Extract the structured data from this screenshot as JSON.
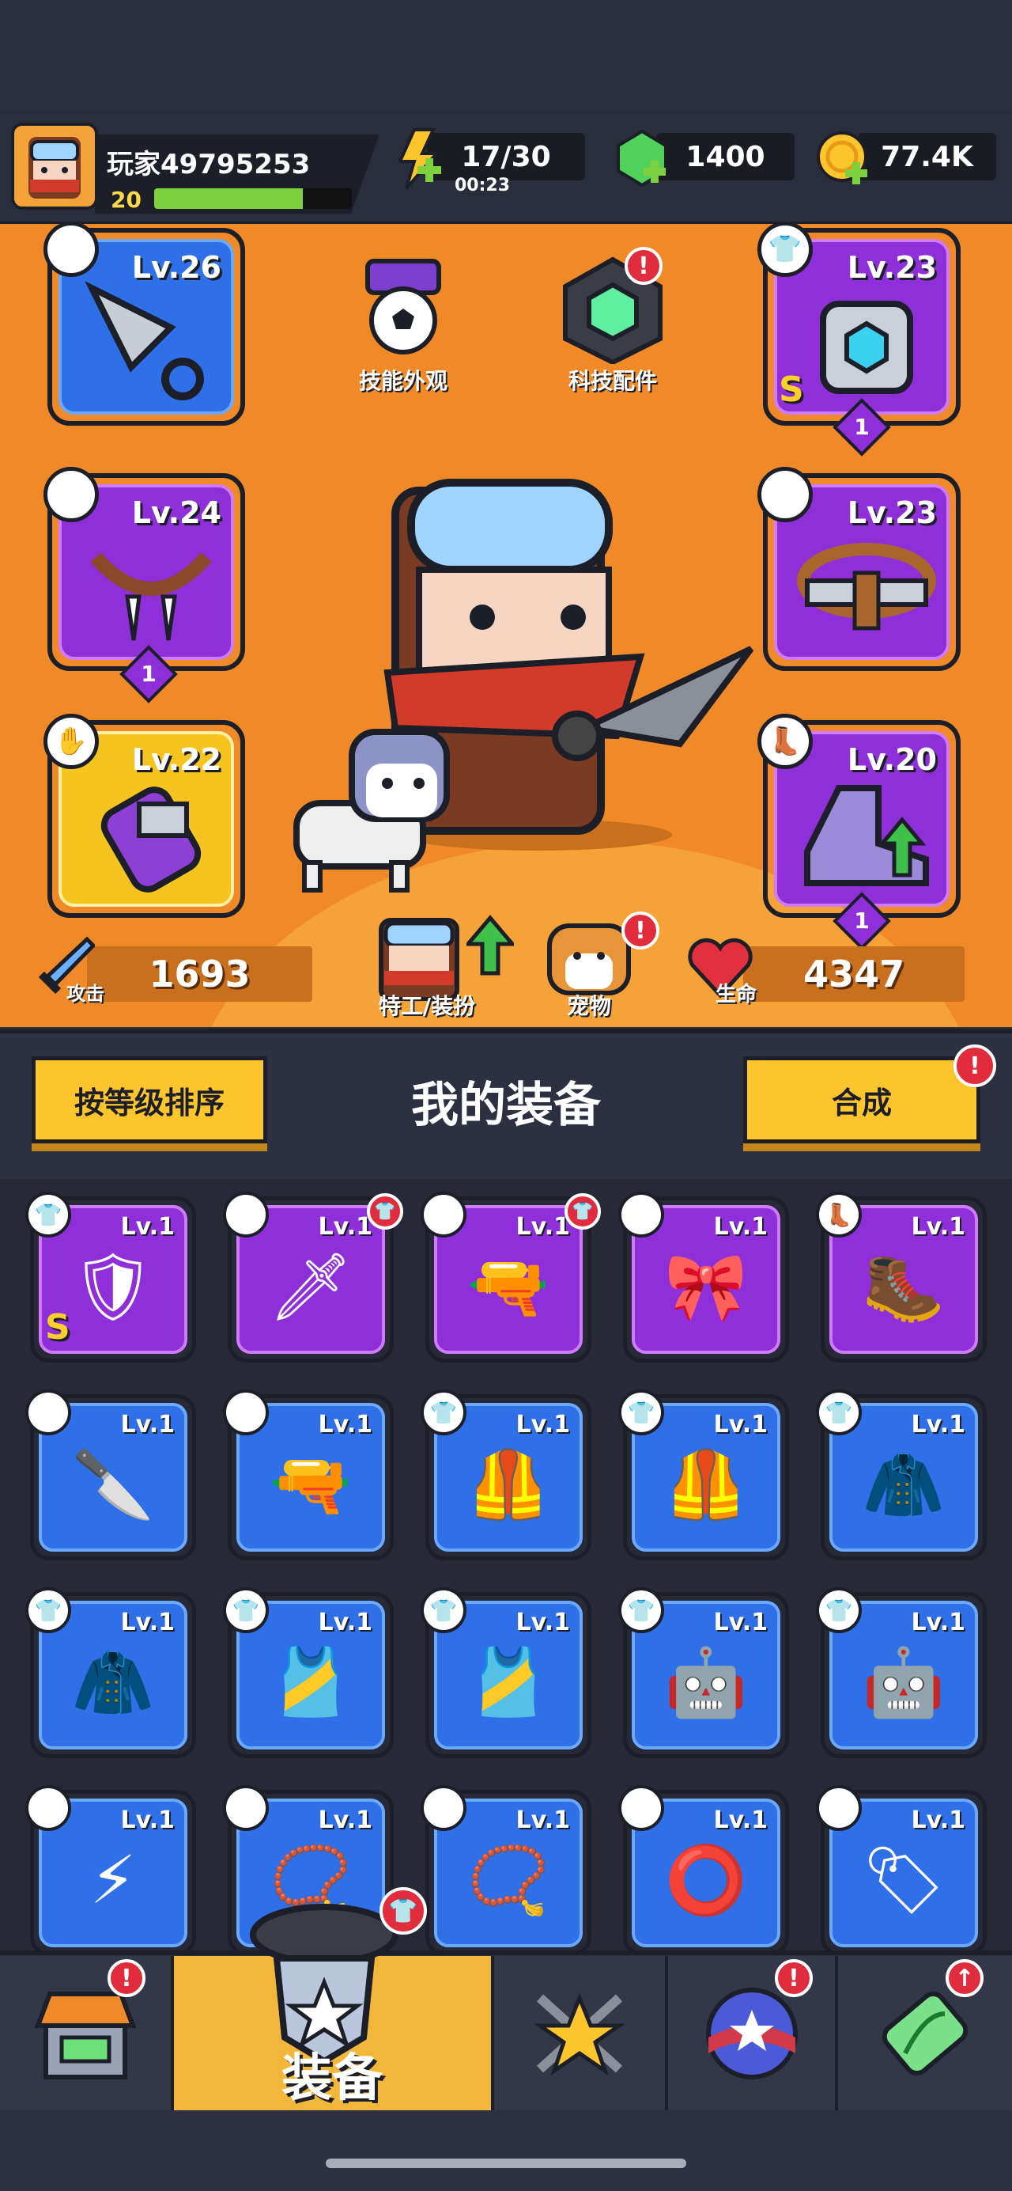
{
  "player": {
    "name": "玩家49795253",
    "level": "20",
    "xp_fraction": 0.75
  },
  "resources": {
    "energy": {
      "value": "17/30",
      "timer": "00:23",
      "icon": "lightning-icon"
    },
    "gems": {
      "value": "1400",
      "icon": "green-gem-icon"
    },
    "coins": {
      "value": "77.4K",
      "icon": "coin-icon"
    }
  },
  "hero_panel": {
    "skill_skin_label": "技能外观",
    "tech_parts_label": "科技配件",
    "agent_outfit_label": "特工/装扮",
    "pet_label": "宠物",
    "attack": {
      "label": "攻击",
      "value": "1693"
    },
    "health": {
      "label": "生命",
      "value": "4347"
    },
    "slots": [
      {
        "id": "weapon",
        "level": "Lv.26",
        "rarity": "blue",
        "type_icon": "weapon-icon",
        "item_icon": "kunai-icon"
      },
      {
        "id": "necklace",
        "level": "Lv.24",
        "rarity": "purple",
        "type_icon": "necklace-icon",
        "item_icon": "fang-necklace-icon",
        "stars": "1"
      },
      {
        "id": "gloves",
        "level": "Lv.22",
        "rarity": "gold",
        "type_icon": "glove-icon",
        "item_icon": "gauntlet-icon"
      },
      {
        "id": "armor",
        "level": "Lv.23",
        "rarity": "purple",
        "type_icon": "armor-icon",
        "item_icon": "mech-armor-icon",
        "stars": "1",
        "badge": "S"
      },
      {
        "id": "belt",
        "level": "Lv.23",
        "rarity": "purple",
        "type_icon": "belt-icon",
        "item_icon": "rope-belt-icon"
      },
      {
        "id": "boots",
        "level": "Lv.20",
        "rarity": "purple",
        "type_icon": "boot-icon",
        "item_icon": "sneaker-icon",
        "stars": "1"
      }
    ]
  },
  "equipment_header": {
    "sort_label": "按等级排序",
    "title": "我的装备",
    "merge_label": "合成"
  },
  "inventory": [
    {
      "level": "Lv.1",
      "rarity": "purple",
      "type": "armor",
      "glyph": "🛡",
      "badge": "S"
    },
    {
      "level": "Lv.1",
      "rarity": "purple",
      "type": "weapon",
      "glyph": "🗡",
      "notice": true
    },
    {
      "level": "Lv.1",
      "rarity": "purple",
      "type": "weapon",
      "glyph": "🔫",
      "notice": true
    },
    {
      "level": "Lv.1",
      "rarity": "purple",
      "type": "belt",
      "glyph": "🎀"
    },
    {
      "level": "Lv.1",
      "rarity": "purple",
      "type": "boots",
      "glyph": "🥾"
    },
    {
      "level": "Lv.1",
      "rarity": "blue",
      "type": "weapon",
      "glyph": "🔪"
    },
    {
      "level": "Lv.1",
      "rarity": "blue",
      "type": "weapon",
      "glyph": "🔫"
    },
    {
      "level": "Lv.1",
      "rarity": "blue",
      "type": "armor",
      "glyph": "🦺"
    },
    {
      "level": "Lv.1",
      "rarity": "blue",
      "type": "armor",
      "glyph": "🦺"
    },
    {
      "level": "Lv.1",
      "rarity": "blue",
      "type": "armor",
      "glyph": "🧥"
    },
    {
      "level": "Lv.1",
      "rarity": "blue",
      "type": "armor",
      "glyph": "🧥"
    },
    {
      "level": "Lv.1",
      "rarity": "blue",
      "type": "armor",
      "glyph": "🎽"
    },
    {
      "level": "Lv.1",
      "rarity": "blue",
      "type": "armor",
      "glyph": "🎽"
    },
    {
      "level": "Lv.1",
      "rarity": "blue",
      "type": "armor",
      "glyph": "🤖"
    },
    {
      "level": "Lv.1",
      "rarity": "blue",
      "type": "armor",
      "glyph": "🤖"
    },
    {
      "level": "Lv.1",
      "rarity": "blue",
      "type": "necklace",
      "glyph": "⚡"
    },
    {
      "level": "Lv.1",
      "rarity": "blue",
      "type": "necklace",
      "glyph": "📿"
    },
    {
      "level": "Lv.1",
      "rarity": "blue",
      "type": "necklace",
      "glyph": "📿"
    },
    {
      "level": "Lv.1",
      "rarity": "blue",
      "type": "necklace",
      "glyph": "⭕"
    },
    {
      "level": "Lv.1",
      "rarity": "blue",
      "type": "necklace",
      "glyph": "🏷"
    }
  ],
  "nav": {
    "shop_icon": "shop-icon",
    "equip_label": "装备",
    "talent_icon": "star-swords-icon",
    "event_icon": "star-ball-icon",
    "dna_icon": "dna-capsule-icon"
  },
  "colors": {
    "hero_bg": "#f08a28",
    "blue_rarity": "#2f6fe8",
    "purple_rarity": "#8f2fd9",
    "gold_rarity": "#f6c41f",
    "button_yellow": "#ffc52d",
    "notice_red": "#e02c3c"
  }
}
